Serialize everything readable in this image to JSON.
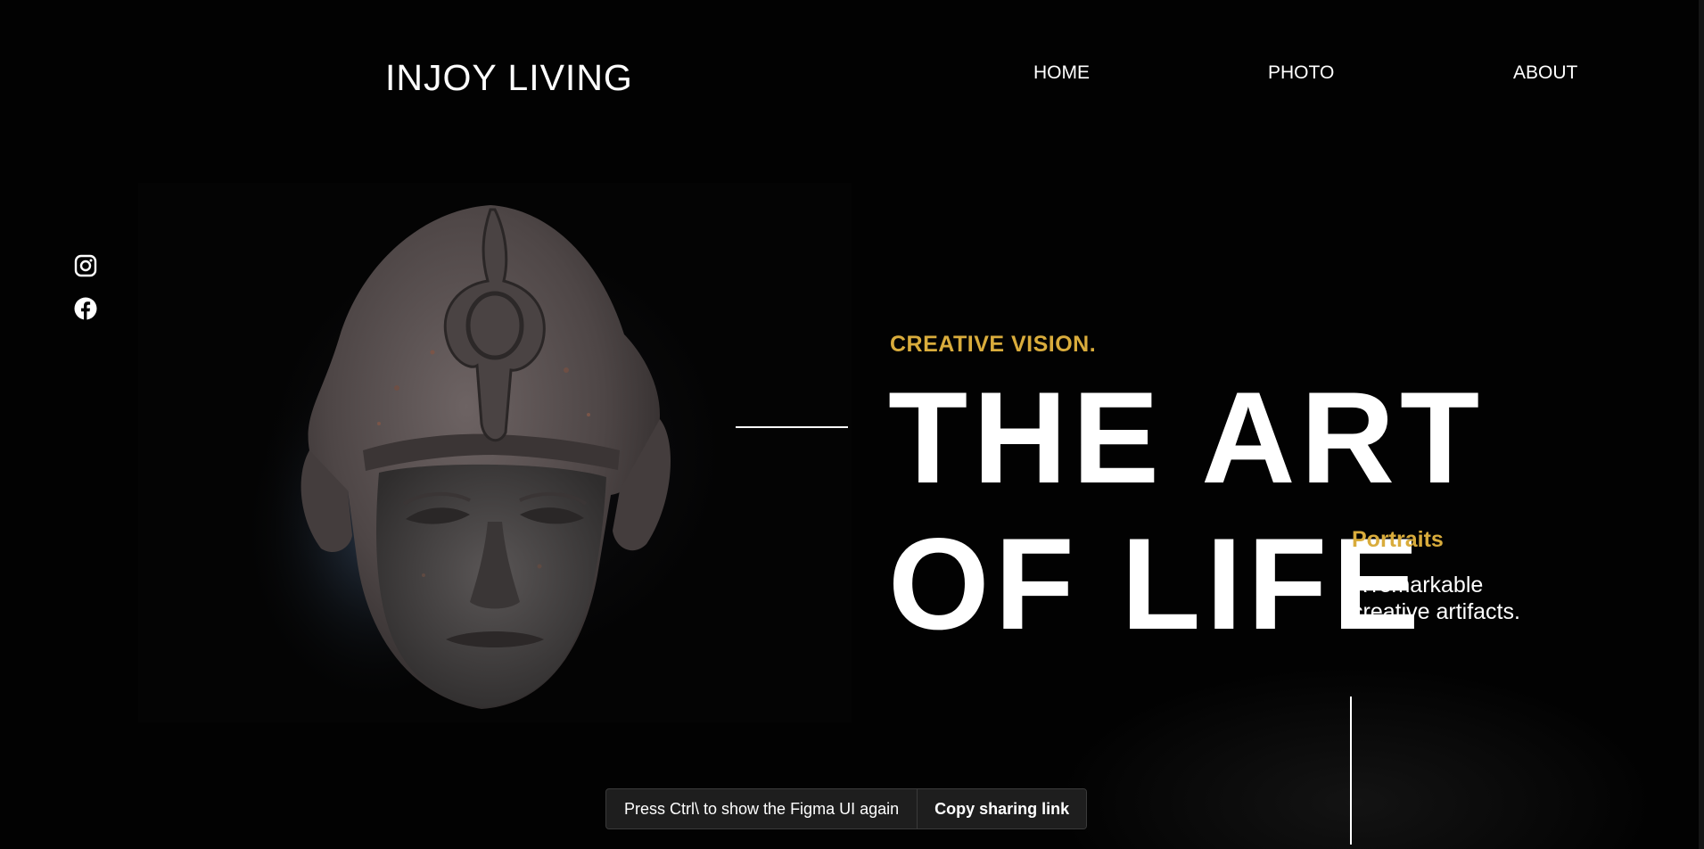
{
  "header": {
    "logo": "INJOY LIVING",
    "nav": [
      {
        "label": "HOME"
      },
      {
        "label": "PHOTO"
      },
      {
        "label": "ABOUT"
      }
    ]
  },
  "social": {
    "items": [
      {
        "icon": "instagram-icon"
      },
      {
        "icon": "facebook-icon"
      }
    ]
  },
  "hero": {
    "image": "stone-pharaoh-head-sculpture",
    "eyebrow": "CREATIVE VISION.",
    "headline_line1": "THE ART",
    "headline_line2": "OF LIFE",
    "side_heading": "Portraits",
    "side_text_line1": "A remarkable",
    "side_text_line2": "creative artifacts."
  },
  "colors": {
    "background": "#020202",
    "accent": "#d9ac3c",
    "text": "#ffffff"
  },
  "figma_toast": {
    "message": "Press Ctrl\\ to show the Figma UI again",
    "button": "Copy sharing link"
  }
}
